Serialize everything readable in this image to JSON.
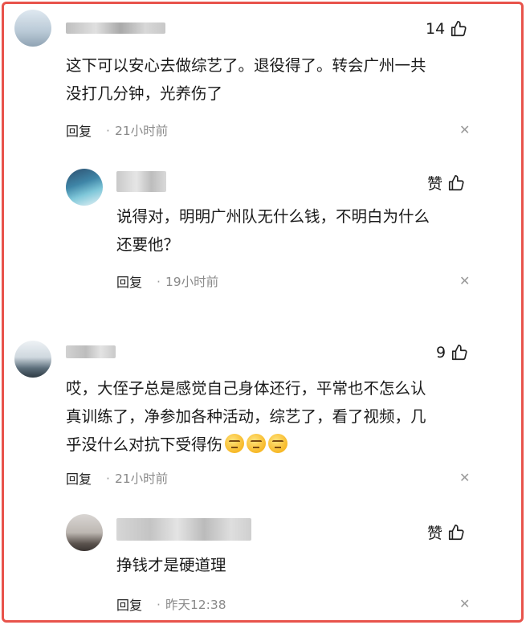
{
  "comments": [
    {
      "likes": "14",
      "text_lines": [
        "这下可以安心去做综艺了。退役得了。转会广州一共",
        "没打几分钟，光养伤了"
      ],
      "reply_label": "回复",
      "time": "21小时前",
      "reply": {
        "likes": "赞",
        "text_lines": [
          "说得对，明明广州队无什么钱，不明白为什么",
          "还要他？"
        ],
        "reply_label": "回复",
        "time": "19小时前"
      }
    },
    {
      "likes": "9",
      "text_lines": [
        "哎，大侄子总是感觉自己身体还行，平常也不怎么认",
        "真训练了，净参加各种活动，综艺了，看了视频，几",
        "乎没什么对抗下受得伤"
      ],
      "reply_label": "回复",
      "time": "21小时前",
      "reply": {
        "likes": "赞",
        "text_lines": [
          "挣钱才是硬道理"
        ],
        "reply_label": "回复",
        "time": "昨天12:38"
      }
    }
  ],
  "icons": {
    "like": "thumbs-up-icon",
    "close": "close-icon",
    "emoji": "smirk-emoji-icon"
  },
  "colors": {
    "frame": "#e8534b",
    "time": "#8a8a8a"
  }
}
